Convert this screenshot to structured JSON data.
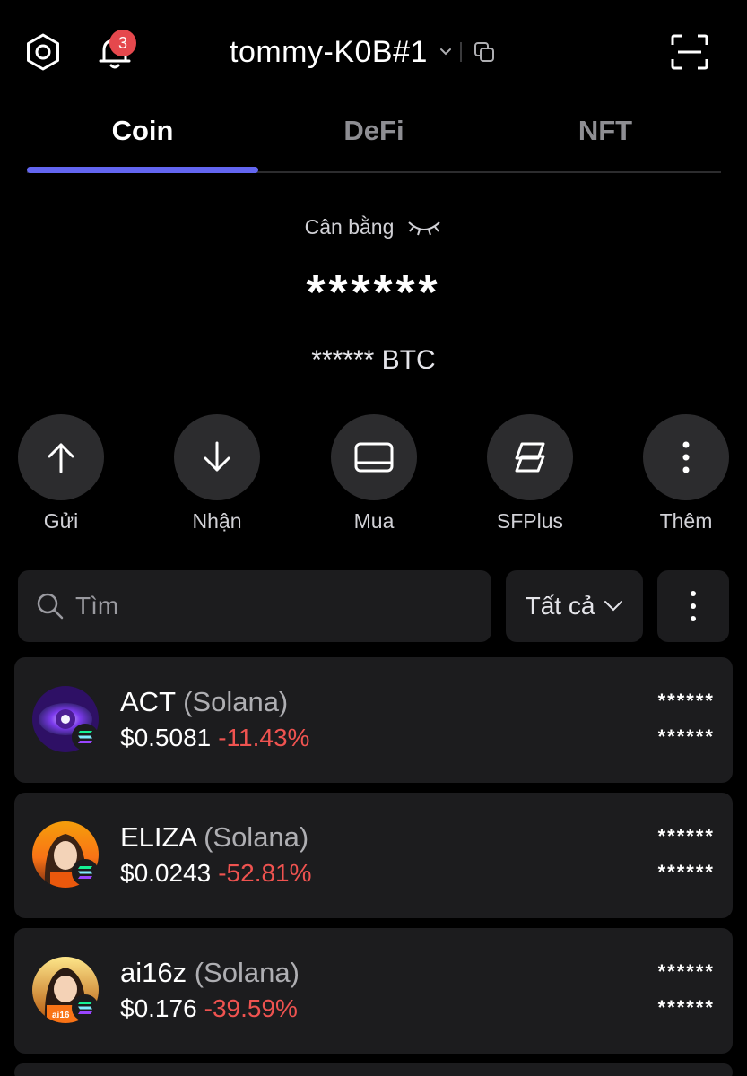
{
  "header": {
    "notification_count": "3",
    "wallet_name": "tommy-K0B#1"
  },
  "tabs": [
    {
      "label": "Coin",
      "active": true
    },
    {
      "label": "DeFi",
      "active": false
    },
    {
      "label": "NFT",
      "active": false
    }
  ],
  "balance": {
    "label": "Cân bằng",
    "hidden_value": "******",
    "btc_value": "****** BTC"
  },
  "actions": [
    {
      "label": "Gửi",
      "icon": "arrow-up-icon"
    },
    {
      "label": "Nhận",
      "icon": "arrow-down-icon"
    },
    {
      "label": "Mua",
      "icon": "card-icon"
    },
    {
      "label": "SFPlus",
      "icon": "sfplus-icon"
    },
    {
      "label": "Thêm",
      "icon": "more-vertical-icon"
    }
  ],
  "search": {
    "placeholder": "Tìm",
    "filter_label": "Tất cả"
  },
  "tokens": [
    {
      "symbol": "ACT",
      "network": "(Solana)",
      "price": "$0.5081",
      "change": "-11.43%",
      "holding": "******",
      "value": "******"
    },
    {
      "symbol": "ELIZA",
      "network": "(Solana)",
      "price": "$0.0243",
      "change": "-52.81%",
      "holding": "******",
      "value": "******"
    },
    {
      "symbol": "ai16z",
      "network": "(Solana)",
      "price": "$0.176",
      "change": "-39.59%",
      "holding": "******",
      "value": "******"
    }
  ],
  "colors": {
    "accent": "#6366f1",
    "negative": "#ef5350",
    "card": "#1c1c1e",
    "badge": "#e5484d"
  }
}
